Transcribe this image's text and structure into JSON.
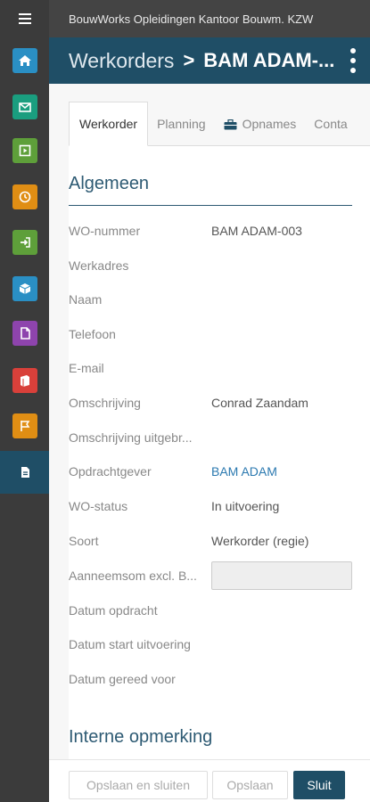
{
  "app": {
    "title": "BouwWorks Opleidingen Kantoor Bouwm. KZW"
  },
  "header": {
    "parent": "Werkorders",
    "separator": ">",
    "current": "BAM ADAM-..."
  },
  "sidebar": {
    "menu_icon": "hamburger-icon",
    "items": [
      {
        "icon": "home-icon",
        "color": "#2a8fc4"
      },
      {
        "icon": "mail-icon",
        "color": "#1a9e7f"
      },
      {
        "icon": "play-icon",
        "color": "#5e9f3a"
      },
      {
        "icon": "clock-icon",
        "color": "#e08e14"
      },
      {
        "icon": "sign-in-icon",
        "color": "#5e9f3a"
      },
      {
        "icon": "cube-icon",
        "color": "#2a8fc4"
      },
      {
        "icon": "file-icon",
        "color": "#8e44ad"
      },
      {
        "icon": "book-icon",
        "color": "#d9403a"
      },
      {
        "icon": "flag-icon",
        "color": "#e08e14"
      },
      {
        "icon": "document-icon",
        "color": "#1f4e66",
        "active": true
      }
    ]
  },
  "tabs": [
    {
      "label": "Werkorder",
      "active": true
    },
    {
      "label": "Planning"
    },
    {
      "label": "Opnames",
      "icon": "briefcase-icon"
    },
    {
      "label": "Conta"
    }
  ],
  "sections": {
    "algemeen": "Algemeen",
    "interne_opmerking": "Interne opmerking"
  },
  "fields": [
    {
      "label": "WO-nummer",
      "value": "BAM ADAM-003"
    },
    {
      "label": "Werkadres",
      "value": ""
    },
    {
      "label": "Naam",
      "value": ""
    },
    {
      "label": "Telefoon",
      "value": ""
    },
    {
      "label": "E-mail",
      "value": ""
    },
    {
      "label": "Omschrijving",
      "value": "Conrad Zaandam"
    },
    {
      "label": "Omschrijving uitgebr...",
      "value": ""
    },
    {
      "label": "Opdrachtgever",
      "value": "BAM ADAM"
    },
    {
      "label": "WO-status",
      "value": "In uitvoering"
    },
    {
      "label": "Soort",
      "value": "Werkorder (regie)"
    },
    {
      "label": "Aanneemsom excl. B...",
      "value": ""
    },
    {
      "label": "Datum opdracht",
      "value": ""
    },
    {
      "label": "Datum start uitvoering",
      "value": ""
    },
    {
      "label": "Datum gereed voor",
      "value": ""
    }
  ],
  "footer": {
    "save_close": "Opslaan en sluiten",
    "save": "Opslaan",
    "close": "Sluit"
  },
  "colors": {
    "brand": "#1f4e66",
    "link": "#2b79b0",
    "section": "#2d5a73"
  }
}
